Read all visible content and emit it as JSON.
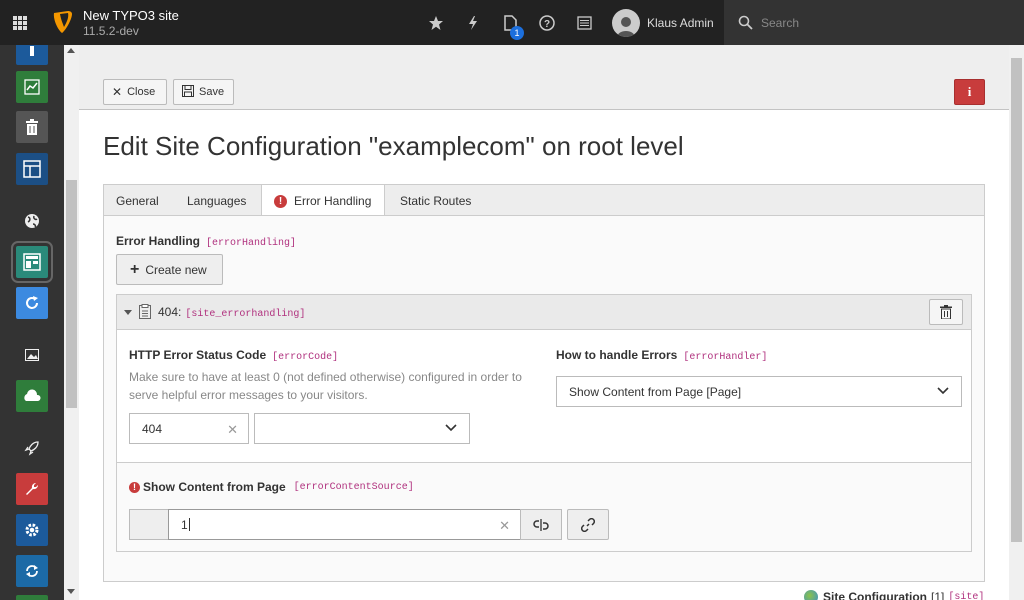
{
  "topbar": {
    "site_name": "New TYPO3 site",
    "version": "11.5.2-dev",
    "user_name": "Klaus Admin",
    "search_placeholder": "Search",
    "open_docs_badge": "1",
    "icons": [
      "bookmark-star-icon",
      "flash-icon",
      "open-documents-icon",
      "help-icon",
      "system-info-icon"
    ]
  },
  "modules": [
    "info-module-icon",
    "reports-module-icon",
    "recycler-module-icon",
    "layout-module-icon",
    "sites-module-icon",
    "site-config-module-icon",
    "refresh-module-icon",
    "media-module-icon",
    "storage-module-icon",
    "rocket-module-icon",
    "maintenance-module-icon",
    "settings-module-icon",
    "upgrade-module-icon"
  ],
  "toolbar": {
    "close_label": "Close",
    "save_label": "Save",
    "info_label": "i"
  },
  "page": {
    "title": "Edit Site Configuration \"examplecom\" on root level"
  },
  "tabs": [
    {
      "label": "General"
    },
    {
      "label": "Languages"
    },
    {
      "label": "Error Handling",
      "active": true,
      "has_error": true
    },
    {
      "label": "Static Routes"
    }
  ],
  "error_handling": {
    "label": "Error Handling",
    "code": "[errorHandling]",
    "create_label": "Create new",
    "record": {
      "title": "404:",
      "code": "[site_errorhandling]",
      "status_code_label": "HTTP Error Status Code",
      "status_code_code": "[errorCode]",
      "status_code_desc": "Make sure to have at least 0 (not defined otherwise) configured in order to serve helpful error messages to your visitors.",
      "status_code_value": "404",
      "status_select_value": "",
      "handler_label": "How to handle Errors",
      "handler_code": "[errorHandler]",
      "handler_value": "Show Content from Page [Page]",
      "content_source_label": "Show Content from Page",
      "content_source_code": "[errorContentSource]",
      "content_source_value": "1"
    }
  },
  "footer": {
    "label": "Site Configuration",
    "count": "[1]",
    "code": "[site]"
  }
}
